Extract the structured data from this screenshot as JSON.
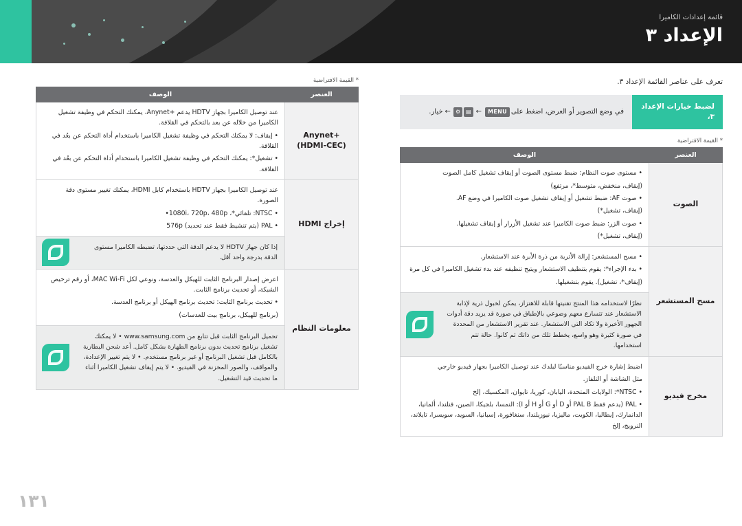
{
  "header": {
    "breadcrumb": "قائمة إعدادات الكاميرا",
    "chapter": "الإعداد ٣"
  },
  "page_number": "١٣١",
  "right_column": {
    "lead": "تعرف على عناصر القائمة الإعداد ٣.",
    "menu_path": {
      "tag": "لضبط خيارات الإعداد ٣،",
      "body_prefix": "في وضع التصوير أو العرض، اضغط على",
      "key_menu": "MENU",
      "key_icon1": "▤",
      "key_icon2": "⚙",
      "body_suffix": "خيار."
    },
    "note": "* القيمة الافتراضية",
    "table": {
      "headers": [
        "العنصر",
        "الوصف"
      ],
      "rows": [
        {
          "item": "الصوت",
          "desc": [
            "• مستوى صوت النظام: ضبط مستوى الصوت أو إيقاف تشغيل كامل الصوت",
            "(إيقاف، منخفض، متوسط*، مرتفع)",
            "• صوت AF: ضبط تشغيل أو إيقاف تشغيل صوت الكاميرا في وضع AF.",
            "(إيقاف، تشغيل*)",
            "• صوت الزر: ضبط صوت الكاميرا عند تشغيل الأزرار أو إيقاف تشغيلها.",
            "(إيقاف، تشغيل*)"
          ]
        },
        {
          "item": "مسح المستشعر",
          "desc": [
            "• مسح المستشعر: إزالة الأتربة من ذرة الأبرة عند الاستشعار.",
            "• بدء الإجراء*: يقوم بتنظيف الاستشعار ويتيح تنظيفه عند بدء تشغيل الكاميرا في كل مرة",
            "(إيقاف*، تشغيل). يقوم بتشغيلها."
          ],
          "tip": "نظرًا لاستخدامه هذا المنتج تقنيتها قابلة للاهتزاز، يمكن لخبول ذرية لإذابة الاستشعار عند تتسارع معهم وضوعي بالإطباق في صورة قد يزيد دقة أدوات الجهور الأخيرة ولا تكاد التي الاستشعار. عند تقرير الاستشعار من المحددة في صورة كثيرة وهو واسع، يخطط تلك من ذاتك ثم كانوا. حالة تتم استخدامها."
        },
        {
          "item": "مخرج فيديو",
          "desc": [
            "اضبط إشارة خرج الفيديو مناسبًا لبلدك عند توصيل الكاميرا بجهاز فيديو خارجي",
            "مثل الشاشة أو التلفاز.",
            "• NTSC*: الولايات المتحدة، اليابان، كوريا، تايوان، المكسيك، إلخ",
            "• PAL (يدعم فقط PAL B أو D أو G أو H أو I): النمسا، بلجيكا، الصين، فنلندا، ألمانيا، الدانمارك، إيطاليا، الكويت، ماليزيا، نيوزيلندا، سنغافورة، إسبانيا، السويد، سويسرا، تايلاند، النرويج، إلخ"
          ]
        }
      ]
    }
  },
  "left_column": {
    "note": "* القيمة الافتراضية",
    "table": {
      "headers": [
        "العنصر",
        "الوصف"
      ],
      "rows": [
        {
          "item": "+Anynet\n(HDMI-CEC)",
          "desc": [
            "عند توصيل الكاميرا بجهاز HDTV يدعم +Anynet، يمكنك التحكم في وظيفة تشغيل الكاميرا من خلاله عن بعد بالتحكم في القلافة.",
            "• إيقاف: لا يمكنك التحكم في وظيفة تشغيل الكاميرا باستخدام أداة التحكم عن بعُد في القلافة.",
            "• تشغيل*: يمكنك التحكم في وظيفة تشغيل الكاميرا باستخدام أداة التحكم عن بعُد في القلافة."
          ]
        },
        {
          "item": "إخراج HDMI",
          "desc": [
            "عند توصيل الكاميرا بجهاز HDTV باستخدام كابل HDMI، يمكنك تغيير مستوى دقة الصورة.",
            "• NTSC: تلقائي*، 1080i، 720p، 480p•",
            "• PAL (يتم تنشيط فقط عند تحديد) 576p"
          ],
          "tip": "إذا كان جهاز HDTV لا يدعم الدقة التي حددتها، تضبطه الكاميرا مستوى الدقة بدرجة واحد أقل."
        },
        {
          "item": "معلومات النظام",
          "desc": [
            "اعرض إصدار البرنامج الثابت للهيكل والعدسة، ونوعي لكل MAC Wi-Fi، أو رقم ترخيص الشبكة، أو تحديث برنامج الثابت.",
            "• تحديث برنامج الثابت: تحديث برنامج الهيكل أو برنامج العدسة.",
            "(برنامج للهيكل، برنامج بيت للعدسات)"
          ],
          "tip": "تحميل البرنامج الثابت قبل تتابع من www.samsung.com • لا يمكنك تشغيل برنامج تحديث بدون برنامج الطهارة بشكل كامل. أعد شحن البطارية بالكامل قبل تشغيل البرنامج أو غير برنامج مستخدم. • لا يتم تغيير الإعدادة، والمواقف، والصور المخزنة في الفيديو. • لا يتم إيقاف تشغيل الكاميرا أثناء ما تحديث قيد التشغيل."
        }
      ]
    }
  }
}
